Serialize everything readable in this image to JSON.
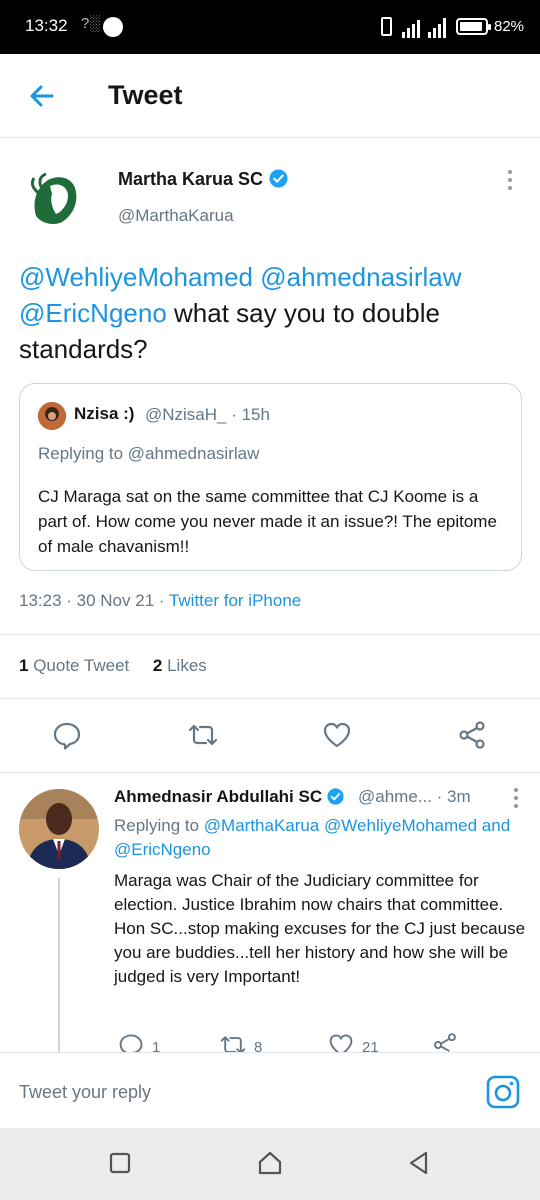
{
  "status_bar": {
    "time": "13:32",
    "signal_label": "?░",
    "battery_percent": "82%"
  },
  "header": {
    "title": "Tweet",
    "back_icon": "arrow-left-icon"
  },
  "tweet": {
    "author_name": "Martha Karua SC",
    "author_handle": "@MarthaKarua",
    "text_parts": {
      "mention1": "@WehliyeMohamed",
      "mention2": "@ahmednasirlaw",
      "mention3": "@EricNgeno",
      "body": " what say you to double standards?"
    },
    "quote": {
      "name": "Nzisa :)",
      "handle_time": "@NzisaH_ · 15h",
      "replying_to": "Replying to @ahmednasirlaw",
      "text": "CJ Maraga sat on the same committee that CJ Koome is a part of. How come you never made it an issue?! The epitome of male chavanism!!"
    },
    "timestamp": "13:23 · 30 Nov 21 · ",
    "source": "Twitter for iPhone",
    "stats": {
      "quote_count": "1",
      "quote_label": " Quote Tweet",
      "like_count": "2",
      "like_label": " Likes"
    }
  },
  "reply": {
    "name": "Ahmednasir Abdullahi SC",
    "handle_time": "@ahme... · 3m",
    "replying_prefix": "Replying to ",
    "replying_mentions": "@MarthaKarua @WehliyeMohamed",
    "replying_and": "and ",
    "replying_last": "@EricNgeno",
    "text": "Maraga was Chair of the Judiciary committee for election. Justice Ibrahim now  chairs that committee. Hon SC...stop making excuses for the CJ just because you are buddies...tell her history and how she will be judged is very Important!",
    "reply_count": "1",
    "retweet_count": "8",
    "like_count": "21"
  },
  "composer": {
    "placeholder": "Tweet your reply"
  },
  "colors": {
    "accent": "#1b95e0",
    "secondary_text": "#657786",
    "border": "#e1e8ed"
  }
}
